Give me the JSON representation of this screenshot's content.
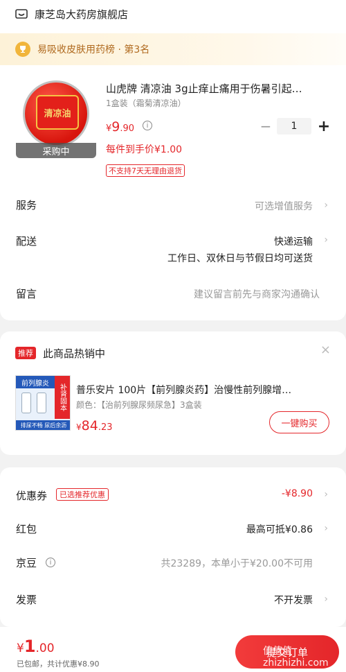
{
  "shop": {
    "name": "康芝岛大药房旗舰店",
    "icon": "shop-icon"
  },
  "rank": {
    "text": "易吸收皮肤用药榜 · 第3名",
    "icon": "trophy-icon"
  },
  "product": {
    "image_label": "清凉油",
    "purchasing_label": "采购中",
    "title": "山虎牌 清凉油 3g止痒止痛用于伤暑引起…",
    "spec": "1盒装（霜菊清凉油）",
    "price_cur": "¥",
    "price_int": "9",
    "price_dec": ".90",
    "each_price": "每件到手价¥1.00",
    "return_tag": "不支持7天无理由退货",
    "quantity": "1",
    "minus": "−",
    "plus": "+"
  },
  "rows": {
    "service": {
      "label": "服务",
      "value": "可选增值服务"
    },
    "delivery": {
      "label": "配送",
      "value": "快递运输",
      "sub": "工作日、双休日与节假日均可送货"
    },
    "message": {
      "label": "留言",
      "placeholder": "建议留言前先与商家沟通确认"
    }
  },
  "recommend": {
    "tag": "推荐",
    "title": "此商品热销中",
    "image_top": "前列腺炎",
    "image_side": "补肾固本",
    "image_bottom": "排尿不畅 尿后余沥",
    "name": "普乐安片 100片【前列腺炎药】治慢性前列腺增…",
    "spec": "颜色：【治前列腺尿频尿急】3盒装",
    "price_cur": "¥",
    "price_int": "84",
    "price_dec": ".23",
    "buy_label": "一键购买",
    "close": "×"
  },
  "discounts": {
    "coupon": {
      "label": "优惠券",
      "tag": "已选推荐优惠",
      "value": "-¥8.90"
    },
    "redpacket": {
      "label": "红包",
      "value": "最高可抵¥0.86"
    },
    "jingdou": {
      "label": "京豆",
      "value": "共23289，本单小于¥20.00不可用"
    },
    "invoice": {
      "label": "发票",
      "value": "不开发票"
    }
  },
  "footer": {
    "total_cur": "¥",
    "total_int": "1",
    "total_dec": ".00",
    "summary": "已包邮，共计优惠¥8.90",
    "submit_label": "提交订单",
    "watermark": "值值值 zhizhizhi.com"
  },
  "colors": {
    "accent": "#e4262a",
    "rank_text": "#b06a1f"
  }
}
